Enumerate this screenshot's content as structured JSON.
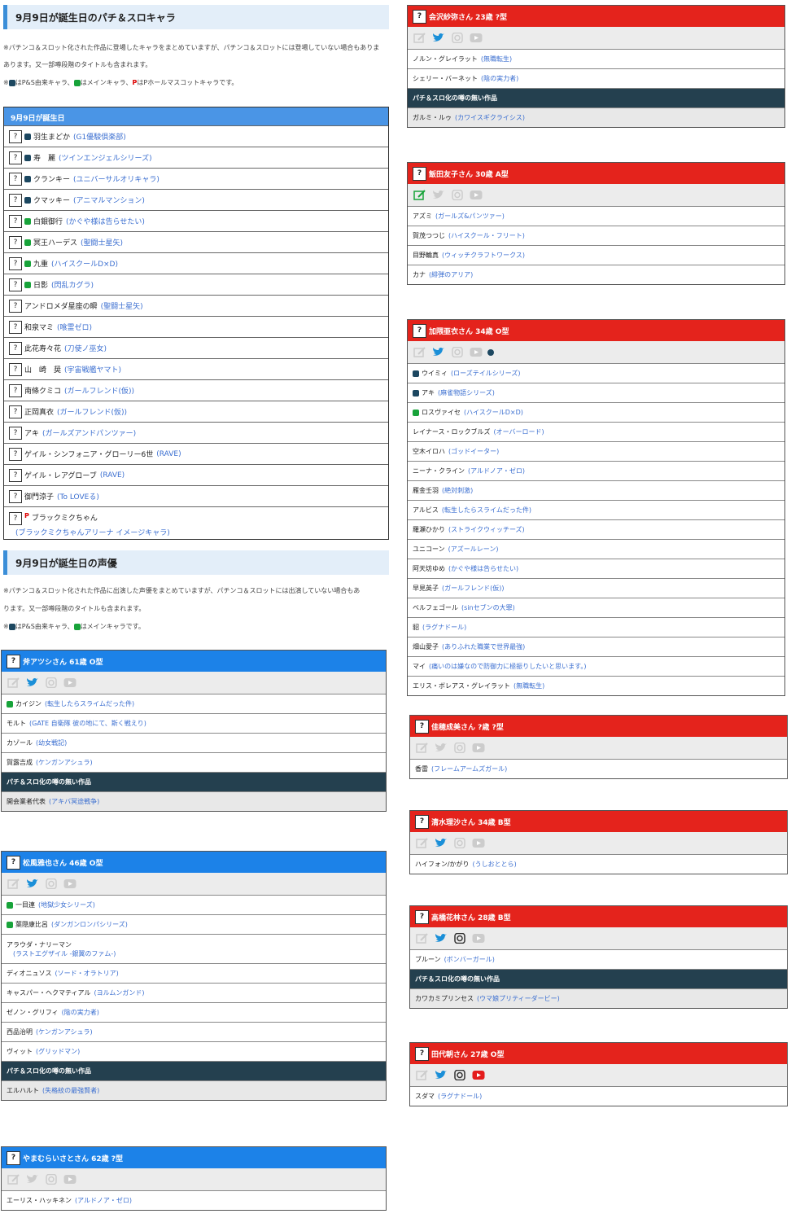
{
  "chars_section": {
    "title": "9月9日が誕生日のパチ＆スロキャラ",
    "note1": "※パチンコ＆スロット化された作品に登場したキャラをまとめていますが、パチンコ＆スロットには登場していない場合もありま",
    "note2": "あります。又一部噂段階のタイトルも含まれます。",
    "note3a": "はP&S由来キャラ、",
    "note3b": "はメインキャラ、",
    "note3c": "はPホールマスコットキャラです。",
    "note3_p": "P",
    "note3_prefix": "※"
  },
  "chars_table": {
    "header": "9月9日が誕生日",
    "q": "?",
    "rows": [
      {
        "mark": "pg",
        "name": "羽生まどか",
        "work": "(G1優駿倶楽部)"
      },
      {
        "mark": "pg",
        "name": "寿　麗",
        "work": "(ツインエンジェルシリーズ)"
      },
      {
        "mark": "pg",
        "name": "クランキー",
        "work": "(ユニバーサルオリキャラ)"
      },
      {
        "mark": "pg",
        "name": "クマッキー",
        "work": "(アニマルマンション)"
      },
      {
        "mark": "xg",
        "name": "白銀御行",
        "work": "(かぐや様は告らせたい)"
      },
      {
        "mark": "xg",
        "name": "冥王ハーデス",
        "work": "(聖闘士星矢)"
      },
      {
        "mark": "xg",
        "name": "九重",
        "work": "(ハイスクールD×D)"
      },
      {
        "mark": "xg",
        "name": "日影",
        "work": "(閃乱カグラ)"
      },
      {
        "mark": "",
        "name": "アンドロメダ星座の瞬",
        "work": "(聖闘士星矢)"
      },
      {
        "mark": "",
        "name": "和泉マミ",
        "work": "(喰霊ゼロ)"
      },
      {
        "mark": "",
        "name": "此花寿々花",
        "work": "(刀使ノ巫女)"
      },
      {
        "mark": "",
        "name": "山　崎　奨",
        "work": "(宇宙戦艦ヤマト)"
      },
      {
        "mark": "",
        "name": "南條クミコ",
        "work": "(ガールフレンド(仮))"
      },
      {
        "mark": "",
        "name": "正岡真衣",
        "work": "(ガールフレンド(仮))"
      },
      {
        "mark": "",
        "name": "アキ",
        "work": "(ガールズアンドパンツァー)"
      },
      {
        "mark": "",
        "name": "ゲイル・シンフォニア・グローリー6世",
        "work": "(RAVE)"
      },
      {
        "mark": "",
        "name": "ゲイル・レアグローブ",
        "work": "(RAVE)"
      },
      {
        "mark": "",
        "name": "御門涼子",
        "work": "(To LOVEる)"
      }
    ],
    "last": {
      "name": "ブラックミクちゃん",
      "work": "(ブラックミクちゃんアリーナ イメージキャラ)",
      "mark": "P"
    }
  },
  "va_section": {
    "title": "9月9日が誕生日の声優",
    "note1": "※パチンコ＆スロット化された作品に出演した声優をまとめていますが、パチンコ＆スロットには出演していない場合もあ",
    "note2": "ります。又一部噂段階のタイトルも含まれます。",
    "note3a": "はP&S由来キャラ、",
    "note3b": "はメインキャラです。",
    "note3_prefix": "※"
  },
  "no_pachi_label": "パチ＆スロ化の噂の無い作品",
  "cards": [
    {
      "id": "ono",
      "color": "blue",
      "title": "斧アツシさん 61歳 O型",
      "icons": [
        0,
        1,
        0,
        0
      ],
      "items": [
        {
          "mark": "xg",
          "name": "カイジン",
          "work": "(転生したらスライムだった件)"
        },
        {
          "name": "モルト",
          "work": "(GATE 自衛隊 彼の地にて、斯く戦えり)"
        },
        {
          "name": "カゾール",
          "work": "(幼女戦記)"
        },
        {
          "name": "賀露吉成",
          "work": "(ケンガンアシュラ)"
        },
        {
          "dark": true
        },
        {
          "gray": true,
          "name": "開会業者代表",
          "work": "(アキバ冥途戦争)"
        }
      ]
    },
    {
      "id": "matsukaze",
      "color": "blue",
      "title": "松風雅也さん 46歳 O型",
      "icons": [
        0,
        1,
        0,
        0
      ],
      "items": [
        {
          "mark": "xg",
          "name": "一目連",
          "work": "(地獄少女シリーズ)"
        },
        {
          "mark": "xg",
          "name": "葉隠康比呂",
          "work": "(ダンガンロンパシリーズ)"
        },
        {
          "tall": true,
          "name": "アラウダ・ナリーマン",
          "work": "(ラストエグザイル -銀翼のファム-)"
        },
        {
          "name": "ディオニュソス",
          "work": "(ソード・オラトリア)"
        },
        {
          "name": "キャスパー・ヘクマティアル",
          "work": "(ヨルムンガンド)"
        },
        {
          "name": "ゼノン・グリフィ",
          "work": "(陰の実力者)"
        },
        {
          "name": "西品治明",
          "work": "(ケンガンアシュラ)"
        },
        {
          "name": "ヴィット",
          "work": "(グリッドマン)"
        },
        {
          "dark": true
        },
        {
          "gray": true,
          "name": "エルハルト",
          "work": "(失格紋の最強賢者)"
        }
      ]
    },
    {
      "id": "yamamura",
      "color": "blue",
      "title": "やまむらいさとさん 62歳 ?型",
      "icons": [
        0,
        0,
        0,
        0
      ],
      "items": [
        {
          "name": "エーリス・ハッキネン",
          "work": "(アルドノア・ゼロ)"
        }
      ]
    },
    {
      "id": "aizawa",
      "color": "red",
      "title": "会沢紗弥さん 23歳 ?型",
      "icons": [
        0,
        1,
        0,
        0
      ],
      "items": [
        {
          "name": "ノルン・グレイラット",
          "work": "(無職転生)"
        },
        {
          "name": "シェリー・バーネット",
          "work": "(陰の実力者)"
        },
        {
          "dark": true
        },
        {
          "gray": true,
          "name": "ガルミ・ルゥ",
          "work": "(カワイスギクライシス)"
        }
      ]
    },
    {
      "id": "iida",
      "color": "red",
      "title": "飯田友子さん 30歳 A型",
      "icons": [
        1,
        0,
        0,
        0
      ],
      "items": [
        {
          "name": "アズミ",
          "work": "(ガールズ&パンツァー)"
        },
        {
          "name": "賀茂つつじ",
          "work": "(ハイスクール・フリート)"
        },
        {
          "name": "目野輪真",
          "work": "(ウィッチクラフトワークス)"
        },
        {
          "name": "カナ",
          "work": "(緋弾のアリア)"
        }
      ]
    },
    {
      "id": "kakuma",
      "color": "red",
      "title": "加隈亜衣さん 34歳 O型",
      "icons": [
        0,
        1,
        0,
        0
      ],
      "extra": true,
      "items": [
        {
          "mark": "pg",
          "name": "ウイミィ",
          "work": "(ローズテイルシリーズ)"
        },
        {
          "mark": "pg",
          "name": "アキ",
          "work": "(麻雀物語シリーズ)"
        },
        {
          "mark": "xg",
          "name": "ロスヴァイセ",
          "work": "(ハイスクールD×D)"
        },
        {
          "name": "レイナース・ロックブルズ",
          "work": "(オーバーロード)"
        },
        {
          "name": "空木イロハ",
          "work": "(ゴッドイーター)"
        },
        {
          "name": "ニーナ・クライン",
          "work": "(アルドノア・ゼロ)"
        },
        {
          "name": "雁金壬羽",
          "work": "(絶対刺激)"
        },
        {
          "name": "アルビス",
          "work": "(転生したらスライムだった件)"
        },
        {
          "name": "羅瀬ひかり",
          "work": "(ストライクウィッチーズ)"
        },
        {
          "name": "ユニコーン",
          "work": "(アズールレーン)"
        },
        {
          "name": "阿天坊ゆめ",
          "work": "(かぐや様は告らせたい)"
        },
        {
          "name": "早見英子",
          "work": "(ガールフレンド(仮))"
        },
        {
          "name": "ベルフェゴール",
          "work": "(sinセブンの大罪)"
        },
        {
          "name": "貂",
          "work": "(ラグナドール)"
        },
        {
          "name": "畑山愛子",
          "work": "(ありふれた職業で世界最強)"
        },
        {
          "name": "マイ",
          "work": "(痛いのは嫌なので防御力に極振りしたいと思います。)"
        },
        {
          "name": "エリス・ボレアス・グレイラット",
          "work": "(無職転生)"
        }
      ]
    },
    {
      "id": "kahono",
      "color": "red",
      "title": "佳穂成美さん ?歳 ?型",
      "icons": [
        0,
        0,
        0,
        0
      ],
      "items": [
        {
          "name": "香雷",
          "work": "(フレームアームズガール)"
        }
      ]
    },
    {
      "id": "shimizu",
      "color": "red",
      "title": "清水理沙さん 34歳 B型",
      "icons": [
        0,
        1,
        0,
        0
      ],
      "items": [
        {
          "name": "ハイフォン/かがり",
          "work": "(うしおととら)"
        }
      ]
    },
    {
      "id": "takahashi",
      "color": "red",
      "title": "高橋花林さん 28歳 B型",
      "icons": [
        0,
        1,
        1,
        0
      ],
      "items": [
        {
          "name": "ブルーン",
          "work": "(ボンバーガール)"
        },
        {
          "dark": true
        },
        {
          "gray": true,
          "name": "カワカミプリンセス",
          "work": "(ウマ娘プリティーダービー)"
        }
      ]
    },
    {
      "id": "tashiro",
      "color": "red",
      "title": "田代朝さん 27歳 O型",
      "icons": [
        0,
        1,
        1,
        1
      ],
      "items": [
        {
          "name": "スダマ",
          "work": "(ラグナドール)"
        }
      ]
    }
  ]
}
